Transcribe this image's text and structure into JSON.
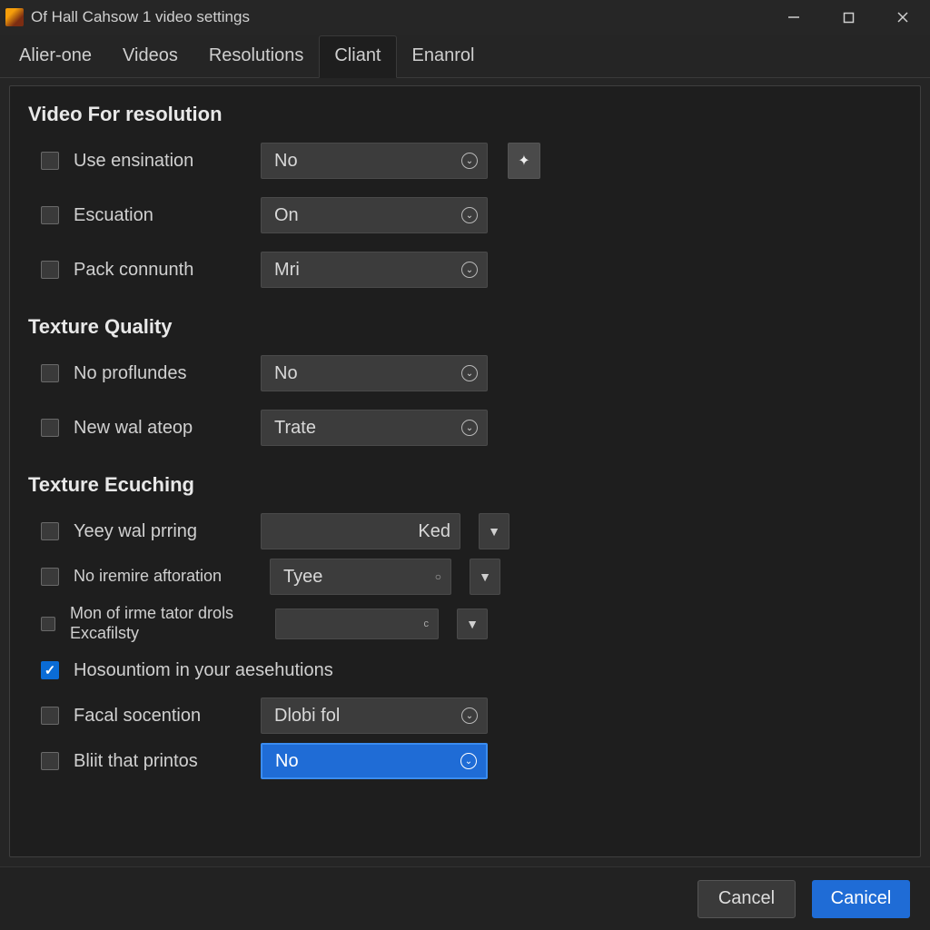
{
  "window": {
    "title": "Of Hall Cahsow 1 video settings"
  },
  "tabs": [
    {
      "label": "Alier-one",
      "active": false
    },
    {
      "label": "Videos",
      "active": false
    },
    {
      "label": "Resolutions",
      "active": false
    },
    {
      "label": "Cliant",
      "active": true
    },
    {
      "label": "Enanrol",
      "active": false
    }
  ],
  "section1": {
    "title": "Video For resolution",
    "opt1": {
      "label": "Use ensination",
      "value": "No"
    },
    "opt2": {
      "label": "Escuation",
      "value": "On"
    },
    "opt3": {
      "label": "Pack connunth",
      "value": "Mri"
    }
  },
  "section2": {
    "title": "Texture Quality",
    "opt1": {
      "label": "No proflundes",
      "value": "No"
    },
    "opt2": {
      "label": "New wal ateop",
      "value": "Trate"
    }
  },
  "section3": {
    "title": "Texture Ecuching",
    "opt1": {
      "label": "Yeey wal prring",
      "value": "Ked"
    },
    "opt2": {
      "label": "No iremire aftoration",
      "value": "Tyee"
    },
    "opt3": {
      "label": "Mon of irme tator drols Excafilsty",
      "value": ""
    },
    "opt4": {
      "label": "Hosountiom in your aesehutions"
    },
    "opt5": {
      "label": "Facal socention",
      "value": "Dlobi fol"
    },
    "opt6": {
      "label": "Bliit that printos",
      "value": "No"
    }
  },
  "footer": {
    "cancel": "Cancel",
    "ok": "Canicel"
  }
}
